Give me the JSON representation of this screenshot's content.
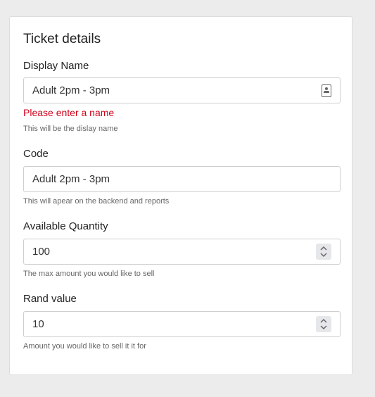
{
  "form": {
    "title": "Ticket details",
    "display_name": {
      "label": "Display Name",
      "value": "Adult 2pm - 3pm",
      "error": "Please enter a name",
      "help": "This will be the dislay name"
    },
    "code": {
      "label": "Code",
      "value": "Adult 2pm - 3pm",
      "help": "This will apear on the backend and reports"
    },
    "available_quantity": {
      "label": "Available Quantity",
      "value": "100",
      "help": "The max amount you would like to sell"
    },
    "rand_value": {
      "label": "Rand value",
      "value": "10",
      "help": "Amount you would like to sell it it for"
    }
  },
  "icons": {
    "display_name_field": "contact-card-icon",
    "number_fields": "stepper-icon"
  },
  "colors": {
    "error": "#d0021b",
    "background": "#ececec",
    "card": "#ffffff"
  }
}
